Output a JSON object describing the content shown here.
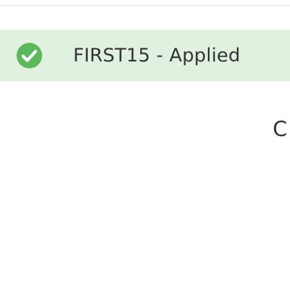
{
  "promo": {
    "label": "FIRST15 - Applied",
    "status_icon": "check-circle-icon",
    "banner_color": "#e0f2df",
    "icon_color": "#5cb85c"
  },
  "partial_text": {
    "visible": "C"
  }
}
